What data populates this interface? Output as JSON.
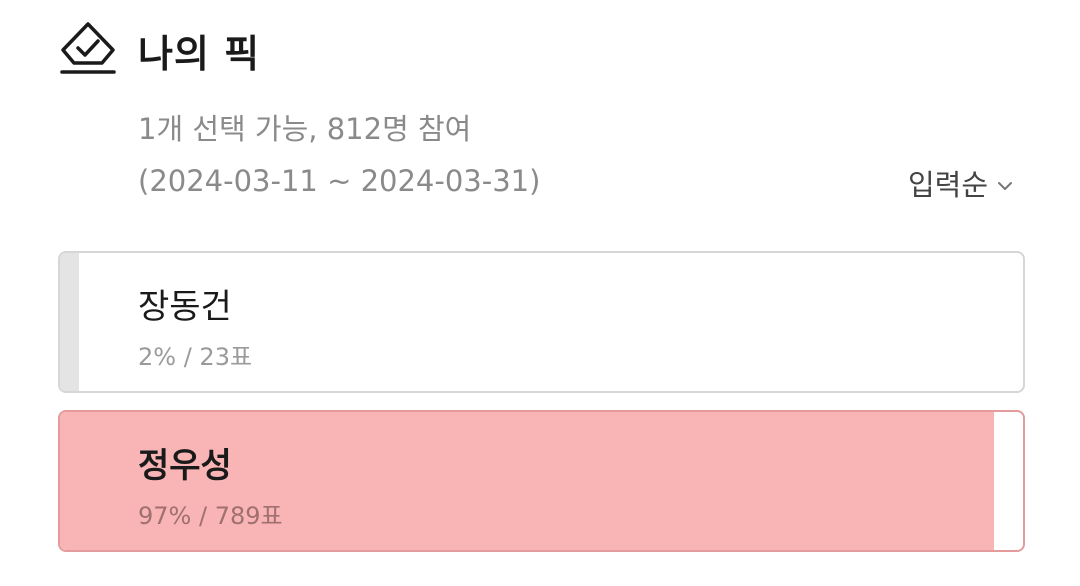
{
  "poll": {
    "title": "나의 픽",
    "icon": "diamond-check-icon",
    "info": "1개 선택 가능, 812명 참여",
    "period": "(2024-03-11 ~ 2024-03-31)",
    "sort_label": "입력순"
  },
  "options": [
    {
      "name": "장동건",
      "stat": "2% / 23표",
      "percent": 2,
      "fill_color": "#e4e4e4"
    },
    {
      "name": "정우성",
      "stat": "97% / 789표",
      "percent": 97,
      "fill_color": "#f9b5b5"
    }
  ],
  "colors": {
    "accent_fill": "#f9b5b5",
    "muted_text": "#8a8a8a"
  }
}
